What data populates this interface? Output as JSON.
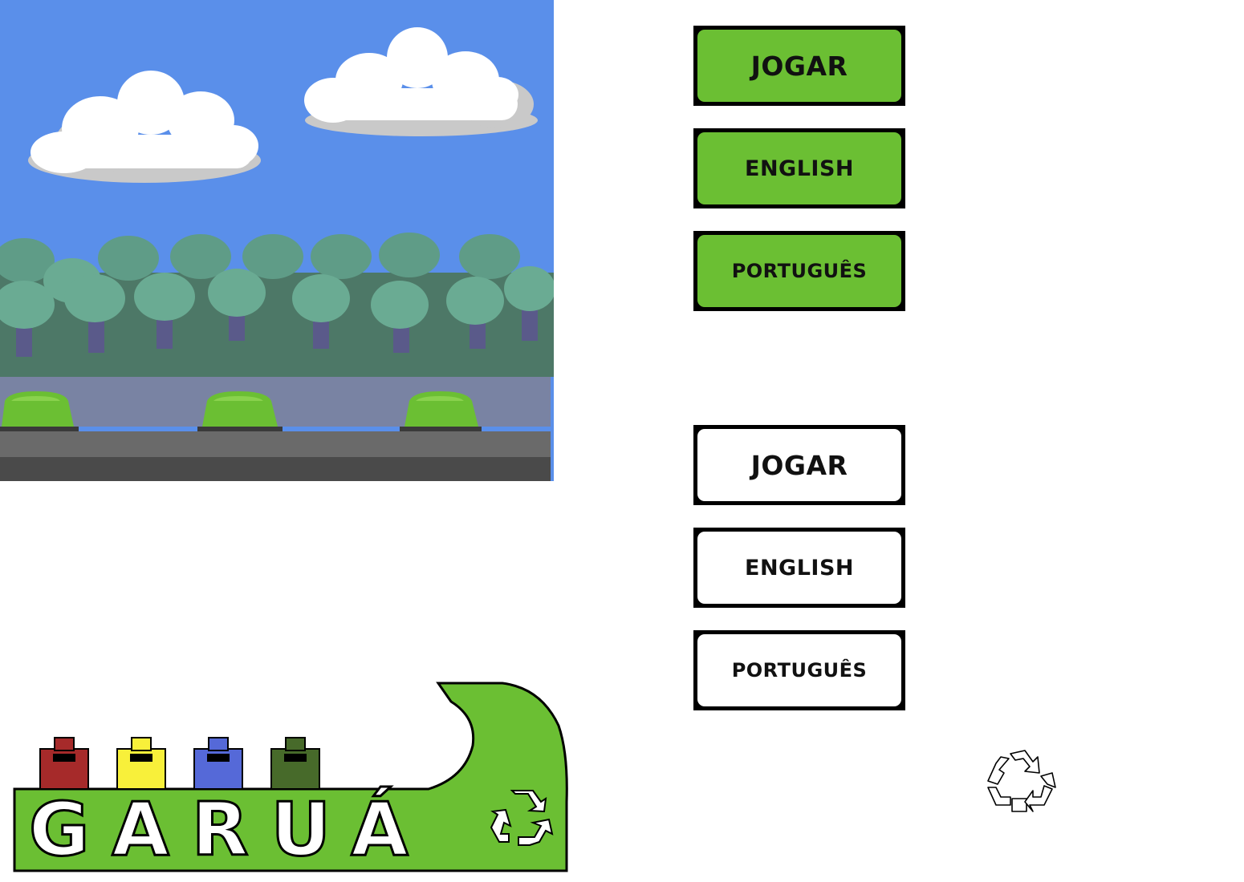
{
  "menu": {
    "normal": {
      "play_label": "JOGAR",
      "english_label": "ENGLISH",
      "portuguese_label": "PORTUGUÊS"
    },
    "hover": {
      "play_label": "JOGAR",
      "english_label": "ENGLISH",
      "portuguese_label": "PORTUGUÊS"
    }
  },
  "logo": {
    "title": "GARUÁ",
    "bin_colors": [
      "#a62a2a",
      "#f8f03a",
      "#5569d8",
      "#476a2a"
    ],
    "accent": "#6bbf33"
  },
  "scene": {
    "sky_color": "#5a8fea",
    "forest_color": "#4d7867",
    "road_color": "#4a4a4a"
  },
  "icons": [
    "recycle-icon"
  ]
}
